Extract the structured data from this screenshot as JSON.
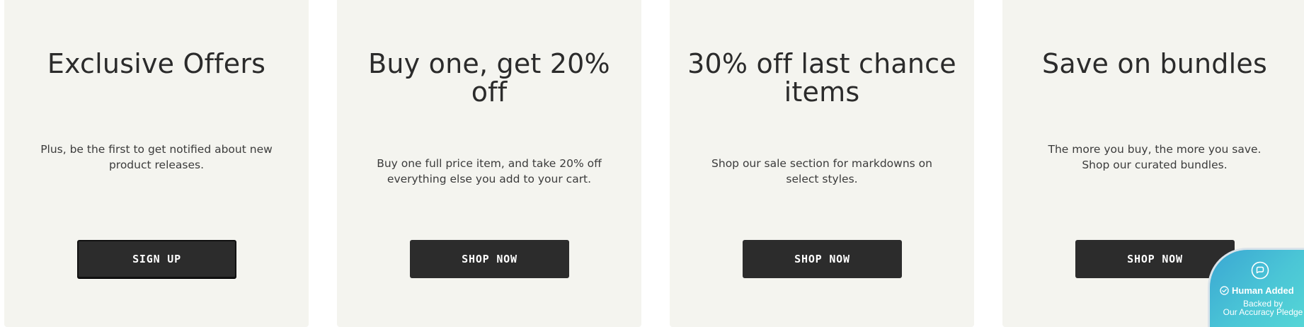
{
  "cards": [
    {
      "title": "Exclusive Offers",
      "description": "Plus, be the first to get notified about new product releases.",
      "button": "SIGN UP"
    },
    {
      "title": "Buy one, get 20% off",
      "description": "Buy one full price item, and take 20% off everything else you add to your cart.",
      "button": "SHOP NOW"
    },
    {
      "title": "30% off last chance items",
      "description": "Shop our sale section for markdowns on select styles.",
      "button": "SHOP NOW"
    },
    {
      "title": "Save on bundles",
      "description": "The more you buy, the more you save. Shop our curated bundles.",
      "button": "SHOP NOW"
    }
  ],
  "badge": {
    "title": "Human Added",
    "line1": "Backed by",
    "line2": "Our Accuracy Pledge",
    "chat_icon": "chat-bubble-icon",
    "check_icon": "check-circle-icon"
  },
  "colors": {
    "card_background": "#f4f4ef",
    "button_background": "#2c2c2c",
    "button_text": "#ffffff",
    "badge_gradient_start": "#3aa7d3",
    "badge_gradient_end": "#58dad6"
  }
}
